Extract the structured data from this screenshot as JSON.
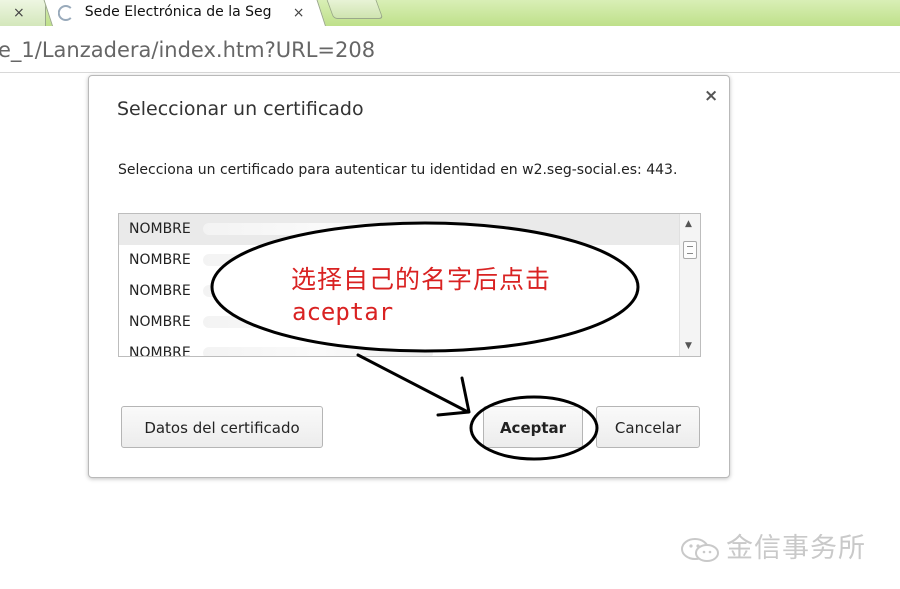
{
  "browser": {
    "tabs": [
      {
        "label": ""
      },
      {
        "label": "Sede Electrónica de la Seg"
      }
    ],
    "close_glyph": "×",
    "url": "e_1/Lanzadera/index.htm?URL=208"
  },
  "dialog": {
    "title": "Seleccionar un certificado",
    "close_glyph": "×",
    "message": "Selecciona un certificado para autenticar tu identidad en w2.seg-social.es: 443.",
    "certificates": [
      {
        "label": "NOMBRE",
        "selected": true
      },
      {
        "label": "NOMBRE",
        "selected": false
      },
      {
        "label": "NOMBRE",
        "selected": false
      },
      {
        "label": "NOMBRE",
        "selected": false
      },
      {
        "label": "NOMBRE",
        "selected": false
      }
    ],
    "scroll_up_glyph": "▲",
    "scroll_down_glyph": "▼",
    "buttons": {
      "details": "Datos del certificado",
      "accept": "Aceptar",
      "cancel": "Cancelar"
    }
  },
  "annotation": {
    "instruction_cn": "选择自己的名字后点击",
    "instruction_es": "aceptar",
    "color": "#d92222"
  },
  "watermark": {
    "text": "金信事务所",
    "icon": "wechat-icon"
  }
}
